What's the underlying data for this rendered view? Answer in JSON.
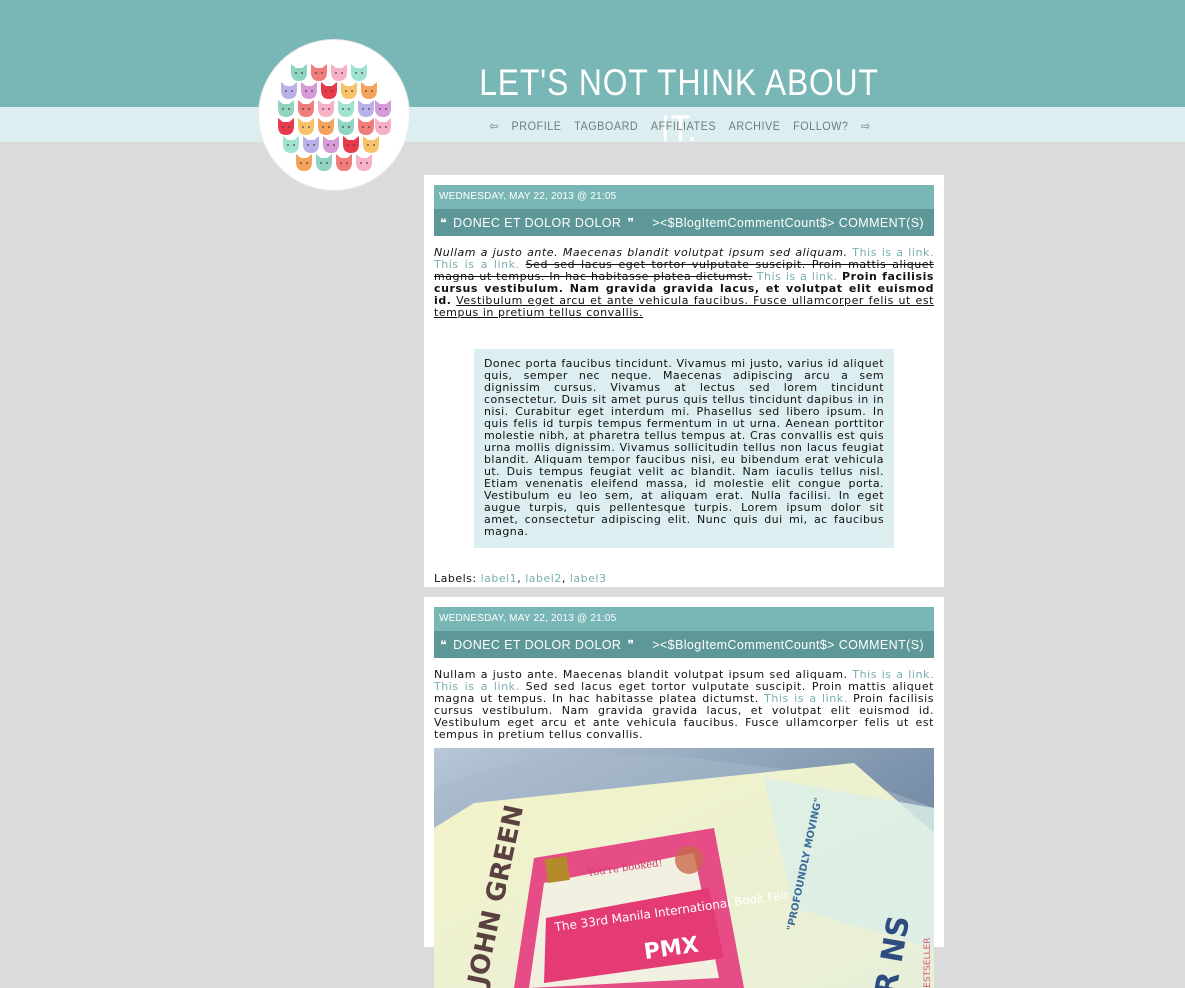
{
  "site": {
    "title": "LET'S NOT THINK ABOUT IT."
  },
  "nav": {
    "prev_arrow": "⇦",
    "next_arrow": "⇨",
    "items": [
      "PROFILE",
      "TAGBOARD",
      "AFFILIATES",
      "ARCHIVE",
      "FOLLOW?"
    ]
  },
  "posts": [
    {
      "date": "WEDNESDAY, MAY 22, 2013 @ 21:05",
      "open_quote": "❝",
      "title": "DONEC ET DOLOR DOLOR",
      "close_quote": "❞",
      "comments": "><$BlogItemCommentCount$> COMMENT(S)",
      "italic": "Nullam a justo ante. Maecenas blandit volutpat ipsum sed aliquam.",
      "link1": "This is a link.",
      "link2": "This is a link.",
      "strike": "Sed sed lacus eget tortor vulputate suscipit. Proin mattis aliquet magna ut tempus. In hac habitasse platea dictumst.",
      "link3": "This is a link.",
      "bold": "Proin facilisis cursus vestibulum. Nam gravida gravida lacus, et volutpat elit euismod id.",
      "underline": "Vestibulum eget arcu et ante vehicula faucibus. Fusce ullamcorper felis ut est tempus in pretium tellus convallis.",
      "quote": "Donec porta faucibus tincidunt. Vivamus mi justo, varius id aliquet quis, semper nec neque. Maecenas adipiscing arcu a sem dignissim cursus. Vivamus at lectus sed lorem tincidunt consectetur. Duis sit amet purus quis tellus tincidunt dapibus in in nisi. Curabitur eget interdum mi. Phasellus sed libero ipsum. In quis felis id turpis tempus fermentum in ut urna. Aenean porttitor molestie nibh, at pharetra tellus tempus at. Cras convallis est quis urna mollis dignissim. Vivamus sollicitudin tellus non lacus feugiat blandit. Aliquam tempor faucibus nisi, eu bibendum erat vehicula ut. Duis tempus feugiat velit ac blandit. Nam iaculis tellus nisl. Etiam venenatis eleifend massa, id molestie elit congue porta. Vestibulum eu leo sem, at aliquam erat. Nulla facilisi. In eget augue turpis, quis pellentesque turpis. Lorem ipsum dolor sit amet, consectetur adipiscing elit. Nunc quis dui mi, ac faucibus magna.",
      "labels_prefix": "Labels:",
      "labels": [
        "label1",
        "label2",
        "label3"
      ],
      "label_sep": ","
    },
    {
      "date": "WEDNESDAY, MAY 22, 2013 @ 21:05",
      "open_quote": "❝",
      "title": "DONEC ET DOLOR DOLOR",
      "close_quote": "❞",
      "comments": "><$BlogItemCommentCount$> COMMENT(S)",
      "text1": "Nullam a justo ante. Maecenas blandit volutpat ipsum sed aliquam.",
      "link1": "This is a link.",
      "link2": "This is a link.",
      "text2": "Sed sed lacus eget tortor vulputate suscipit. Proin mattis aliquet magna ut tempus. In hac habitasse platea dictumst.",
      "link3": "This is a link.",
      "text3": "Proin facilisis cursus vestibulum. Nam gravida gravida lacus, et volutpat elit euismod id. Vestibulum eget arcu et ante vehicula faucibus. Fusce ullamcorper felis ut est tempus in pretium tellus convallis.",
      "photo_text": {
        "author": "JOHN GREEN",
        "ticket_top": "You're booked!",
        "ticket_main": "The 33rd Manila International Book Fair",
        "ticket_logo": "PMX",
        "quote": "\"PROFOUNDLY MOVING\"",
        "bestseller": "BESTSELLER",
        "title_fragment": "ER NS"
      }
    }
  ],
  "colors": {
    "header": "#79b7b6",
    "nav_band": "#dceef0",
    "page_bg": "#dbdbdb",
    "title_bar": "#5d9797",
    "link": "#79aeb0"
  }
}
